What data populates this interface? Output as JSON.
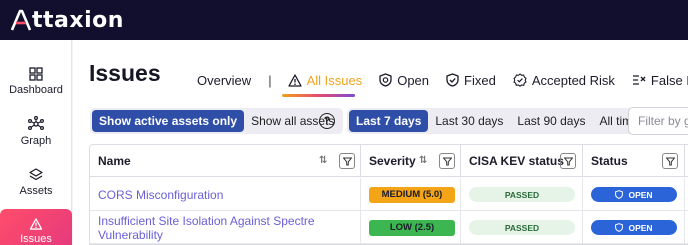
{
  "app": {
    "brand": "ttaxion"
  },
  "sidebar": {
    "items": [
      {
        "label": "Dashboard",
        "icon": "dashboard-icon"
      },
      {
        "label": "Graph",
        "icon": "graph-icon"
      },
      {
        "label": "Assets",
        "icon": "layers-icon"
      },
      {
        "label": "Issues",
        "icon": "warning-icon"
      }
    ]
  },
  "page": {
    "title": "Issues"
  },
  "tabs": [
    {
      "label": "Overview"
    },
    {
      "label": "All Issues",
      "icon": "warning-icon"
    },
    {
      "label": "Open",
      "icon": "open-shield-icon"
    },
    {
      "label": "Fixed",
      "icon": "check-shield-icon"
    },
    {
      "label": "Accepted Risk",
      "icon": "badge-check-icon"
    },
    {
      "label": "False Positi",
      "icon": "false-positive-icon"
    }
  ],
  "tab_separator": "|",
  "filters": {
    "asset_scope": {
      "options": [
        "Show active assets only",
        "Show all assets"
      ],
      "selected": "Show active assets only"
    },
    "help": "?",
    "range": {
      "options": [
        "Last 7 days",
        "Last 30 days",
        "Last 90 days",
        "All time"
      ],
      "selected": "Last 7 days"
    },
    "search_placeholder": "Filter by gr"
  },
  "table": {
    "columns": [
      "Name",
      "Severity",
      "CISA KEV status",
      "Status"
    ],
    "rows": [
      {
        "name": "CORS Misconfiguration",
        "severity": "MEDIUM (5.0)",
        "kev": "PASSED",
        "status": "OPEN"
      },
      {
        "name": "Insufficient Site Isolation Against Spectre Vulnerability",
        "severity": "LOW (2.5)",
        "kev": "PASSED",
        "status": "OPEN"
      }
    ]
  },
  "colors": {
    "topbar": "#120e2e",
    "accent_blue": "#2e4ea7",
    "tab_active": "#f0a31d",
    "severity_medium": "#f3a417",
    "severity_low": "#3cb651",
    "status_open": "#2b63d9",
    "link": "#6a5fd6"
  }
}
